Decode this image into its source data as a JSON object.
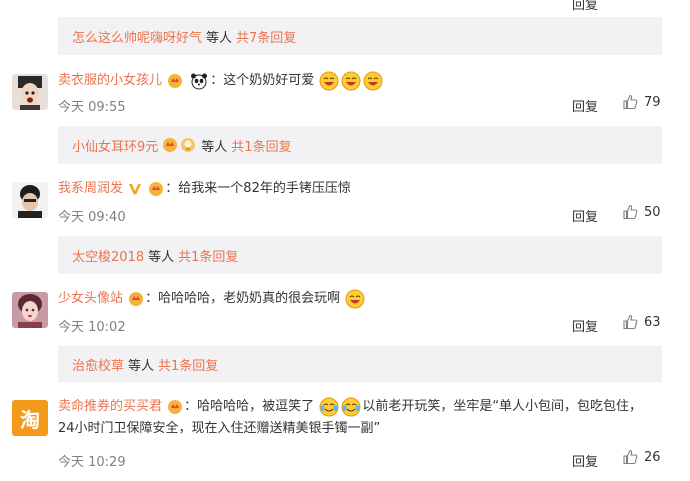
{
  "top_partial": {
    "reply": "回复",
    "like_count": ""
  },
  "reply_summaries": [
    {
      "names": "怎么这么帅呢嗨呀好气",
      "deng": "等人",
      "count": "共7条回复"
    },
    {
      "names": "小仙女耳环9元",
      "deng": "等人",
      "count": "共1条回复"
    },
    {
      "names": "太空梭2018",
      "deng": "等人",
      "count": "共1条回复"
    },
    {
      "names": "治愈校草",
      "deng": "等人",
      "count": "共1条回复"
    }
  ],
  "comments": [
    {
      "user": "卖衣服的小女孩儿",
      "text": "：这个奶奶好可爱",
      "time": "今天 09:55",
      "reply": "回复",
      "likes": "79"
    },
    {
      "user": "我系周润发",
      "text": "：给我来一个82年的手铐压压惊",
      "time": "今天 09:40",
      "reply": "回复",
      "likes": "50"
    },
    {
      "user": "少女头像站",
      "text": "：哈哈哈哈，老奶奶真的很会玩啊",
      "time": "今天 10:02",
      "reply": "回复",
      "likes": "63"
    },
    {
      "user": "卖命推券的买买君",
      "text": "：哈哈哈哈，被逗笑了",
      "text2": "以前老开玩笑，坐牢是“单人小包间，包吃包住，24小时门卫保障安全，现在入住还赠送精美银手镯一副”",
      "time": "今天 10:29",
      "reply": "回复",
      "likes": "26",
      "avatar_char": "淘"
    }
  ],
  "colors": {
    "link": "#eb7350",
    "reply_bg": "#f2f2f5",
    "meta": "#808080",
    "text": "#333333"
  }
}
